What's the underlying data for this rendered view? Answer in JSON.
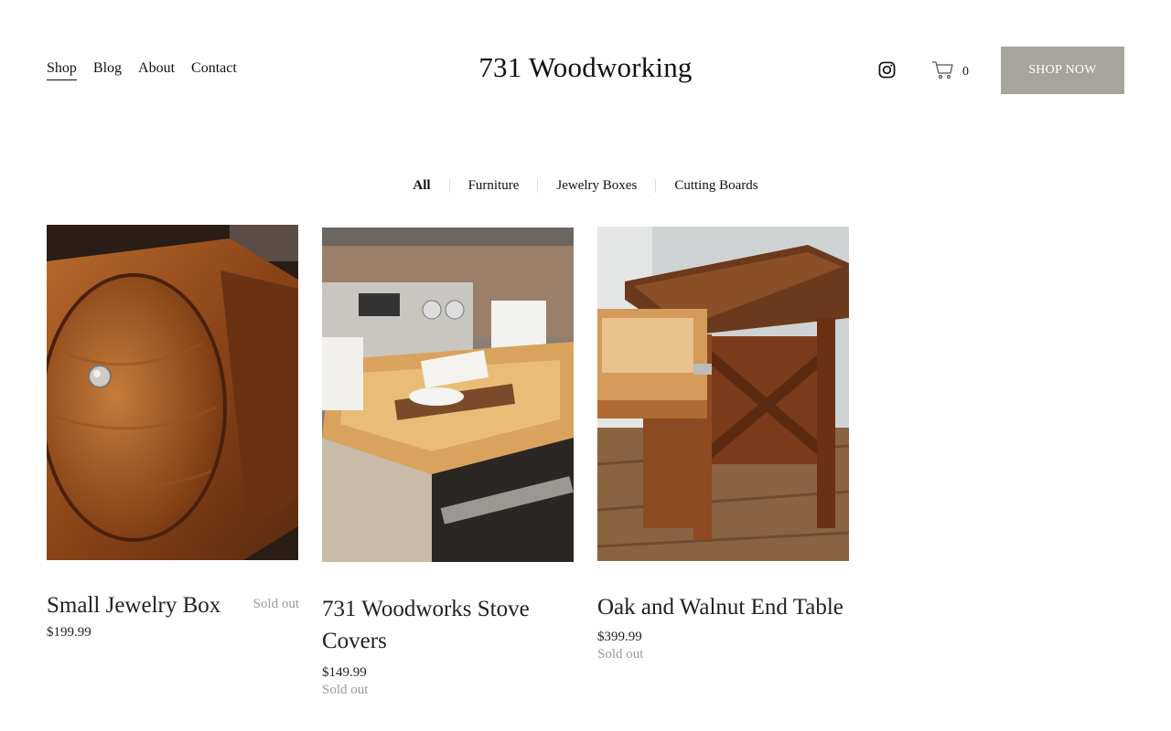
{
  "header": {
    "nav": [
      "Shop",
      "Blog",
      "About",
      "Contact"
    ],
    "title": "731 Woodworking",
    "cart_count": "0",
    "cta_label": "Shop Now"
  },
  "filters": [
    "All",
    "Furniture",
    "Jewelry Boxes",
    "Cutting Boards"
  ],
  "products": [
    {
      "name": "Small Jewelry Box",
      "price": "$199.99",
      "status": "Sold out"
    },
    {
      "name": "731 Woodworks Stove Covers",
      "price": "$149.99",
      "status": "Sold out"
    },
    {
      "name": "Oak and Walnut End Table",
      "price": "$399.99",
      "status": "Sold out"
    }
  ],
  "icons": {
    "social": "instagram-icon",
    "cart": "shopping-cart-icon"
  },
  "colors": {
    "cta_background": "#a6a49c",
    "sold_out_text": "#999999",
    "text": "#111111"
  }
}
